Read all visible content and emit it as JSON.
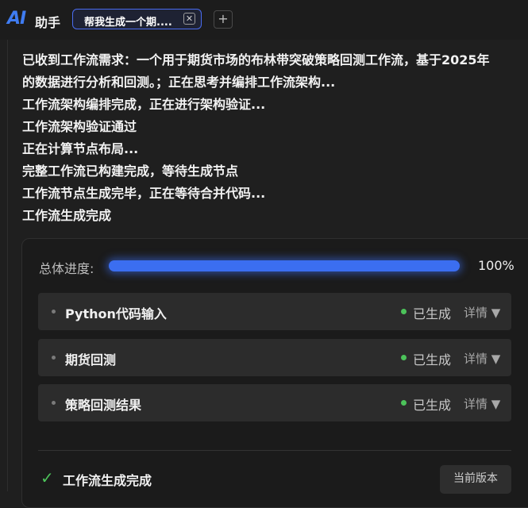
{
  "header": {
    "logo": "AI",
    "title": "助手",
    "tab_label": "帮我生成一个期....",
    "tab_close_icon": "close-icon",
    "add_tab_symbol": "+"
  },
  "messages": [
    "已收到工作流需求：一个用于期货市场的布林带突破策略回测工作流，基于2025年",
    "的数据进行分析和回测。；正在思考并编排工作流架构...",
    "工作流架构编排完成，正在进行架构验证...",
    "工作流架构验证通过",
    "正在计算节点布局...",
    "完整工作流已构建完成，等待生成节点",
    "工作流节点生成完毕，正在等待合并代码...",
    "工作流生成完成"
  ],
  "progress": {
    "label": "总体进度:",
    "value_percent": 100,
    "text": "100%"
  },
  "nodes": [
    {
      "name": "Python代码输入",
      "status": "已生成",
      "detail": "详情 ▼"
    },
    {
      "name": "期货回测",
      "status": "已生成",
      "detail": "详情 ▼"
    },
    {
      "name": "策略回测结果",
      "status": "已生成",
      "detail": "详情 ▼"
    }
  ],
  "footer": {
    "check_icon": "✓",
    "done_text": "工作流生成完成",
    "version_button": "当前版本"
  },
  "colors": {
    "accent": "#3b6ef0",
    "status_ok": "#4cc35a",
    "background": "#1f1f1f"
  }
}
